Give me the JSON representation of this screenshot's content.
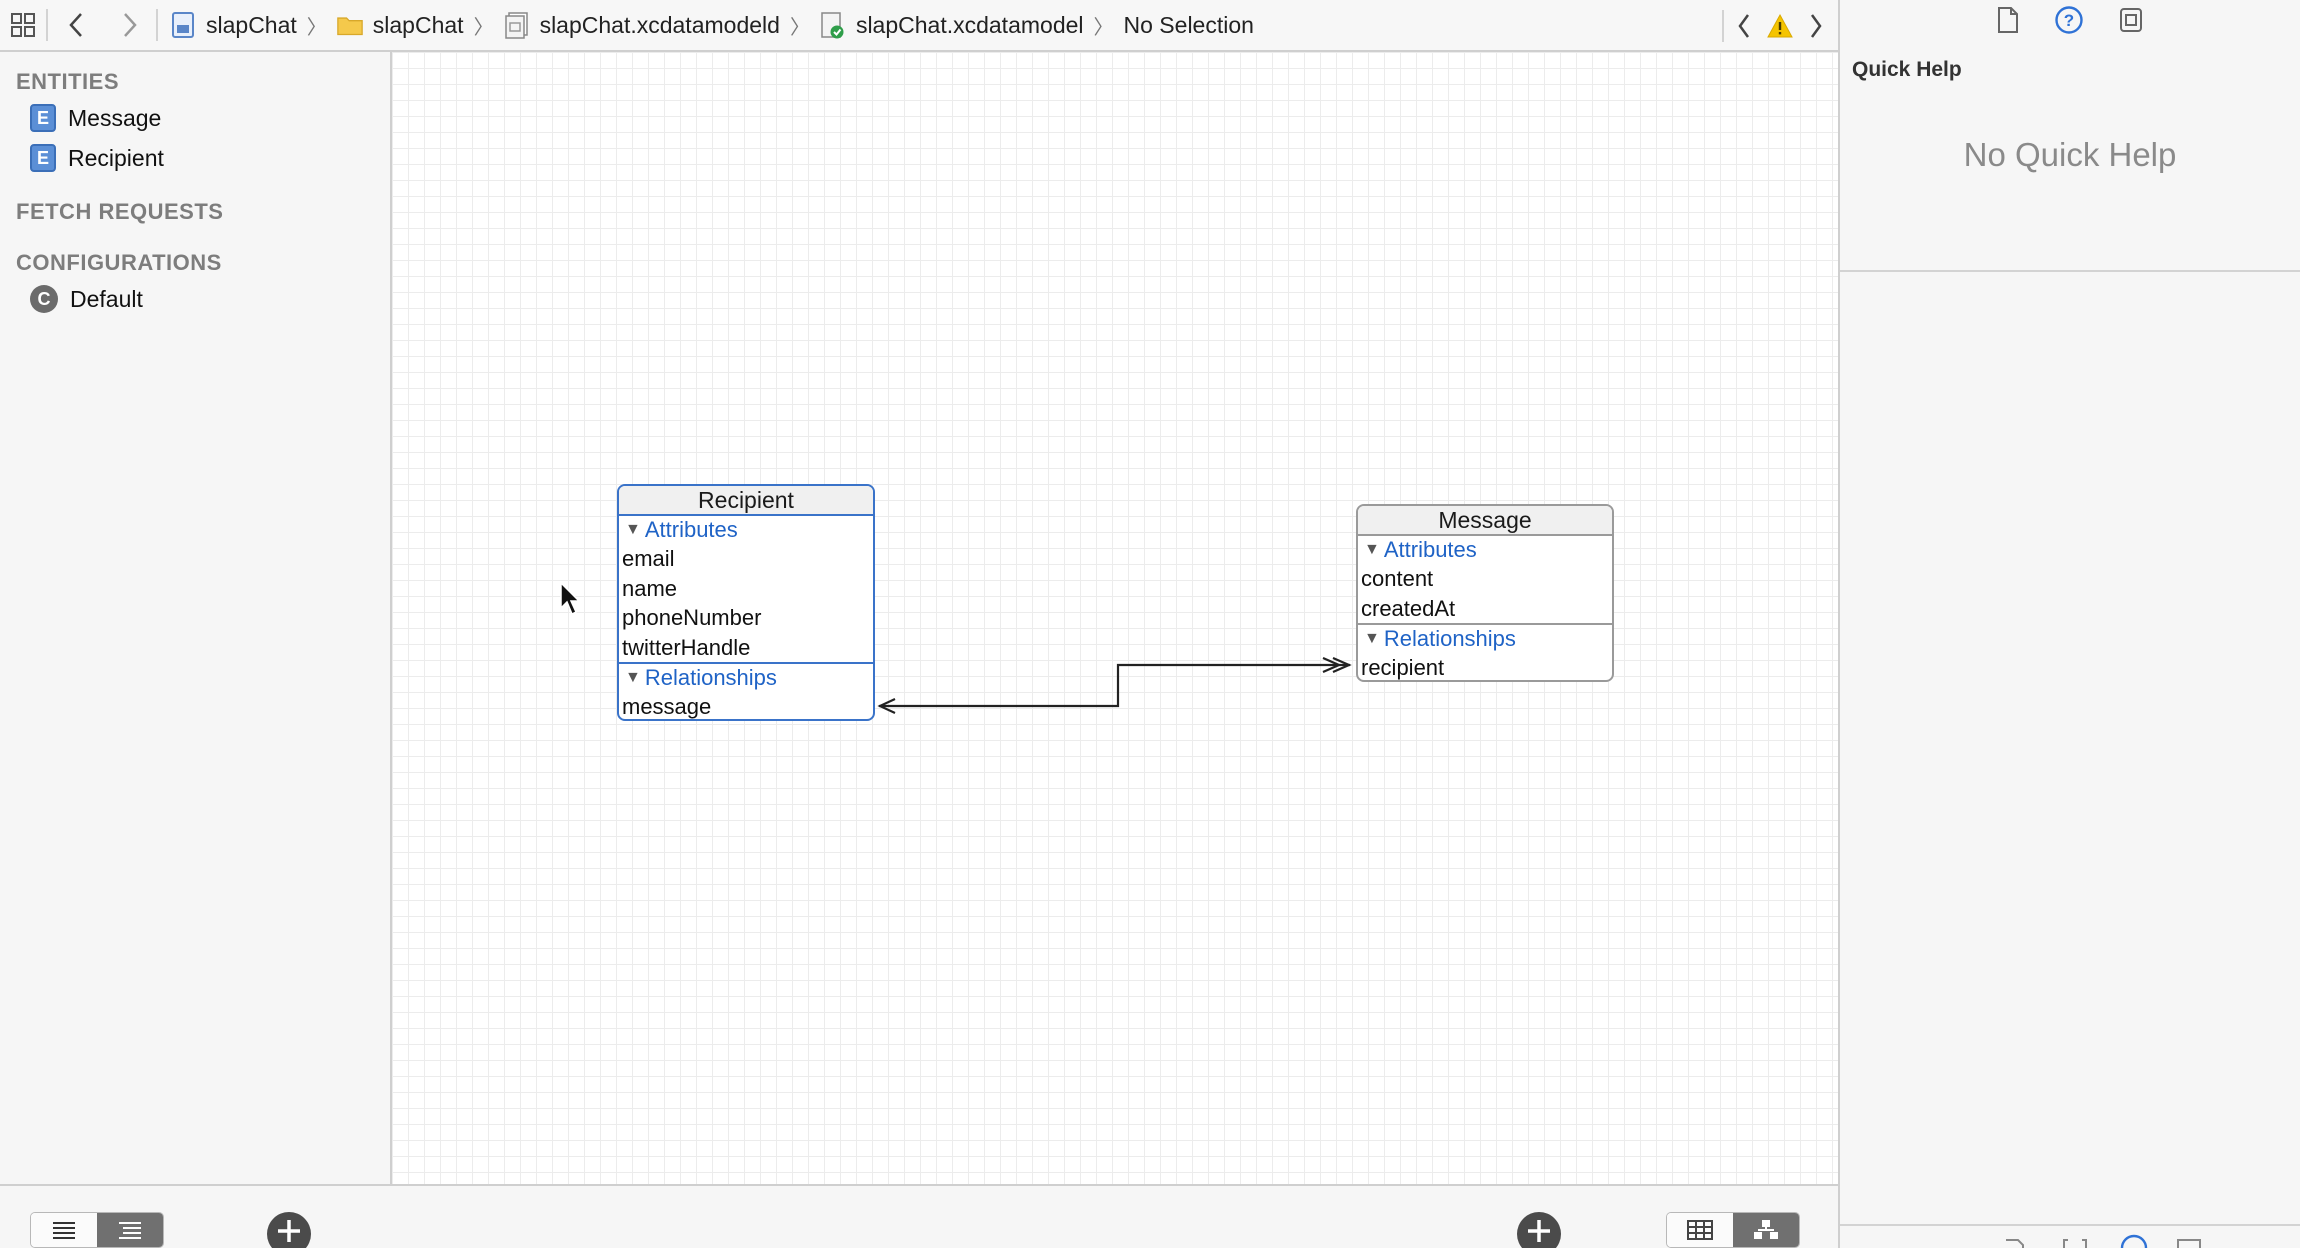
{
  "breadcrumb": {
    "items": [
      {
        "label": "slapChat",
        "icon": "project-icon"
      },
      {
        "label": "slapChat",
        "icon": "folder-icon"
      },
      {
        "label": "slapChat.xcdatamodeld",
        "icon": "data-model-bundle-icon"
      },
      {
        "label": "slapChat.xcdatamodel",
        "icon": "data-model-file-icon"
      },
      {
        "label": "No Selection",
        "icon": ""
      }
    ]
  },
  "navigator": {
    "entities_title": "ENTITIES",
    "entities": [
      {
        "badge": "E",
        "label": "Message"
      },
      {
        "badge": "E",
        "label": "Recipient"
      }
    ],
    "fetch_requests_title": "FETCH REQUESTS",
    "configurations_title": "CONFIGURATIONS",
    "configurations": [
      {
        "badge": "C",
        "label": "Default"
      }
    ]
  },
  "graph": {
    "recipient": {
      "name": "Recipient",
      "attributes_label": "Attributes",
      "attributes": [
        "email",
        "name",
        "phoneNumber",
        "twitterHandle"
      ],
      "relationships_label": "Relationships",
      "relationships": [
        "message"
      ]
    },
    "message": {
      "name": "Message",
      "attributes_label": "Attributes",
      "attributes": [
        "content",
        "createdAt"
      ],
      "relationships_label": "Relationships",
      "relationships": [
        "recipient"
      ]
    }
  },
  "inspector": {
    "title": "Quick Help",
    "empty_text": "No Quick Help"
  },
  "colors": {
    "accent": "#1f63c6",
    "selection": "#3a73c9",
    "warning": "#f5c400"
  }
}
